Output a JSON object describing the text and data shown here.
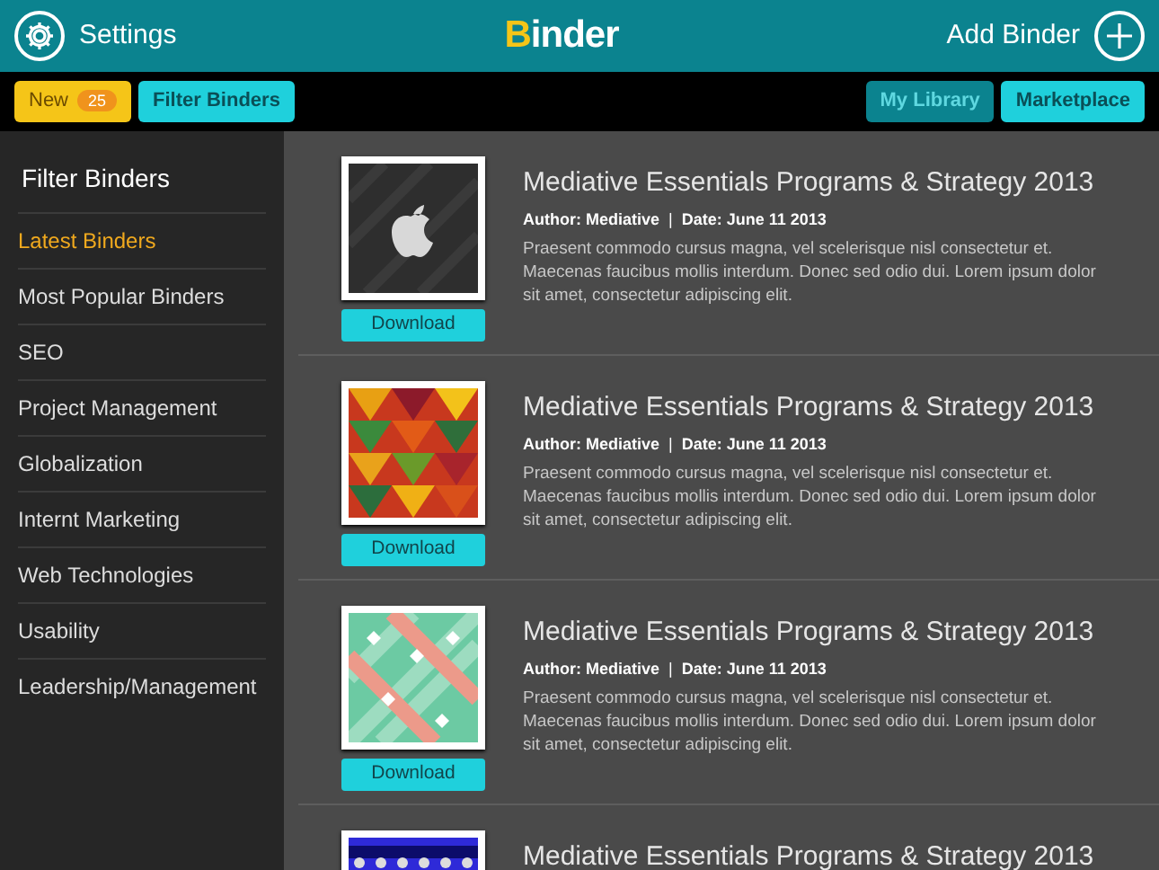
{
  "header": {
    "settings_label": "Settings",
    "logo": "Binder",
    "add_label": "Add Binder"
  },
  "toolbar": {
    "left": [
      {
        "label": "New",
        "count": "25",
        "kind": "new"
      },
      {
        "label": "Filter Binders",
        "kind": "plain"
      }
    ],
    "right": [
      {
        "label": "My Library",
        "selected": true
      },
      {
        "label": "Marketplace",
        "selected": false
      }
    ]
  },
  "sidebar": {
    "title": "Filter Binders",
    "items": [
      {
        "label": "Latest Binders",
        "selected": true
      },
      {
        "label": "Most Popular Binders",
        "selected": false
      },
      {
        "label": "SEO",
        "selected": false
      },
      {
        "label": "Project Management",
        "selected": false
      },
      {
        "label": "Globalization",
        "selected": false
      },
      {
        "label": "Internt Marketing",
        "selected": false
      },
      {
        "label": "Web Technologies",
        "selected": false
      },
      {
        "label": "Usability",
        "selected": false
      },
      {
        "label": "Leadership/Management",
        "selected": false
      }
    ]
  },
  "binders": [
    {
      "kind": "apple",
      "title": "Mediative Essentials Programs & Strategy 2013",
      "meta": "**Author: Mediative**  |  **Date: June 11 2013**",
      "description": "Praesent commodo cursus magna, vel scelerisque nisl consectetur et. Maecenas faucibus mollis interdum. Donec sed odio dui. Lorem ipsum dolor sit amet, consectetur adipiscing elit.",
      "button": "Download"
    },
    {
      "kind": "triangles",
      "title": "Mediative Essentials Programs & Strategy 2013",
      "meta": "**Author: Mediative**  |  **Date: June 11 2013**",
      "description": "Praesent commodo cursus magna, vel scelerisque nisl consectetur et. Maecenas faucibus mollis interdum. Donec sed odio dui. Lorem ipsum dolor sit amet, consectetur adipiscing elit.",
      "button": "Download"
    },
    {
      "kind": "plaid",
      "title": "Mediative Essentials Programs & Strategy 2013",
      "meta": "**Author: Mediative**  |  **Date: June 11 2013**",
      "description": "Praesent commodo cursus magna, vel scelerisque nisl consectetur et. Maecenas faucibus mollis interdum. Donec sed odio dui. Lorem ipsum dolor sit amet, consectetur adipiscing elit.",
      "button": "Download"
    },
    {
      "kind": "stars",
      "title": "Mediative Essentials Programs & Strategy 2013"
    }
  ]
}
